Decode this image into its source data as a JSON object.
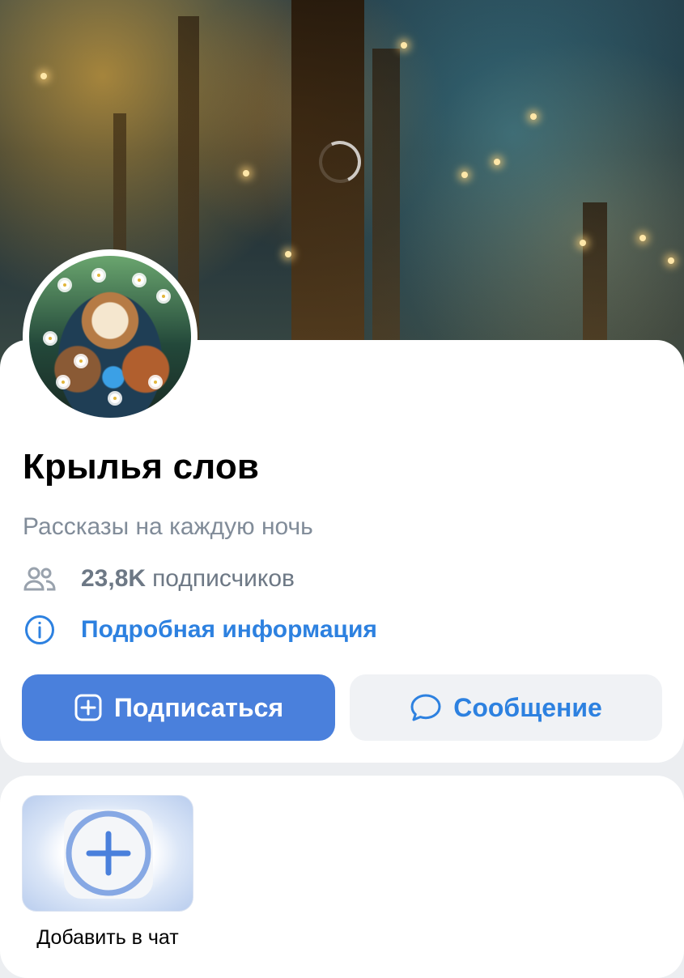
{
  "group": {
    "name": "Крылья слов",
    "description": "Рассказы на каждую ночь",
    "followers_count": "23,8K",
    "followers_label": "подписчиков",
    "info_link": "Подробная информация"
  },
  "actions": {
    "subscribe_label": "Подписаться",
    "message_label": "Сообщение"
  },
  "chat": {
    "add_label": "Добавить в чат"
  },
  "icons": {
    "followers": "people-icon",
    "info": "info-circle-icon",
    "subscribe": "plus-square-icon",
    "message": "chat-bubble-icon",
    "add": "plus-circle-icon",
    "loading": "spinner-icon"
  },
  "colors": {
    "accent": "#2d81e0",
    "primary_button": "#4a80dc",
    "secondary_button": "#f0f2f5",
    "muted_text": "#818c99",
    "page_background": "#eceef1"
  }
}
